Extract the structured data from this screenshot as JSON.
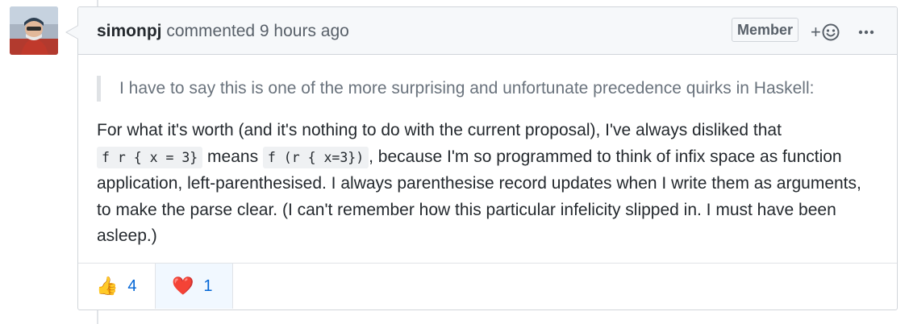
{
  "comment": {
    "author": "simonpj",
    "action_text": "commented",
    "timestamp": "9 hours ago",
    "badge": "Member",
    "quote": "I have to say this is one of the more surprising and unfortunate precedence quirks in Haskell:",
    "body": {
      "part1": "For what it's worth (and it's nothing to do with the current proposal), I've always disliked that ",
      "code1": "f r { x = 3}",
      "part2": " means ",
      "code2": "f (r { x=3})",
      "part3": ", because I'm so programmed to think of infix space as function application, left-parenthesised. I always parenthesise record updates when I write them as arguments, to make the parse clear. (I can't remember how this particular infelicity slipped in. I must have been asleep.)"
    },
    "reactions": [
      {
        "emoji": "👍",
        "icon": "thumbs-up",
        "count": "4",
        "active": false
      },
      {
        "emoji": "❤️",
        "icon": "heart",
        "count": "1",
        "active": true
      }
    ]
  },
  "colors": {
    "header_bg": "#f6f8fa",
    "border": "#d1d5da",
    "link_blue": "#0366d6",
    "reaction_active_bg": "#f1f8ff"
  }
}
